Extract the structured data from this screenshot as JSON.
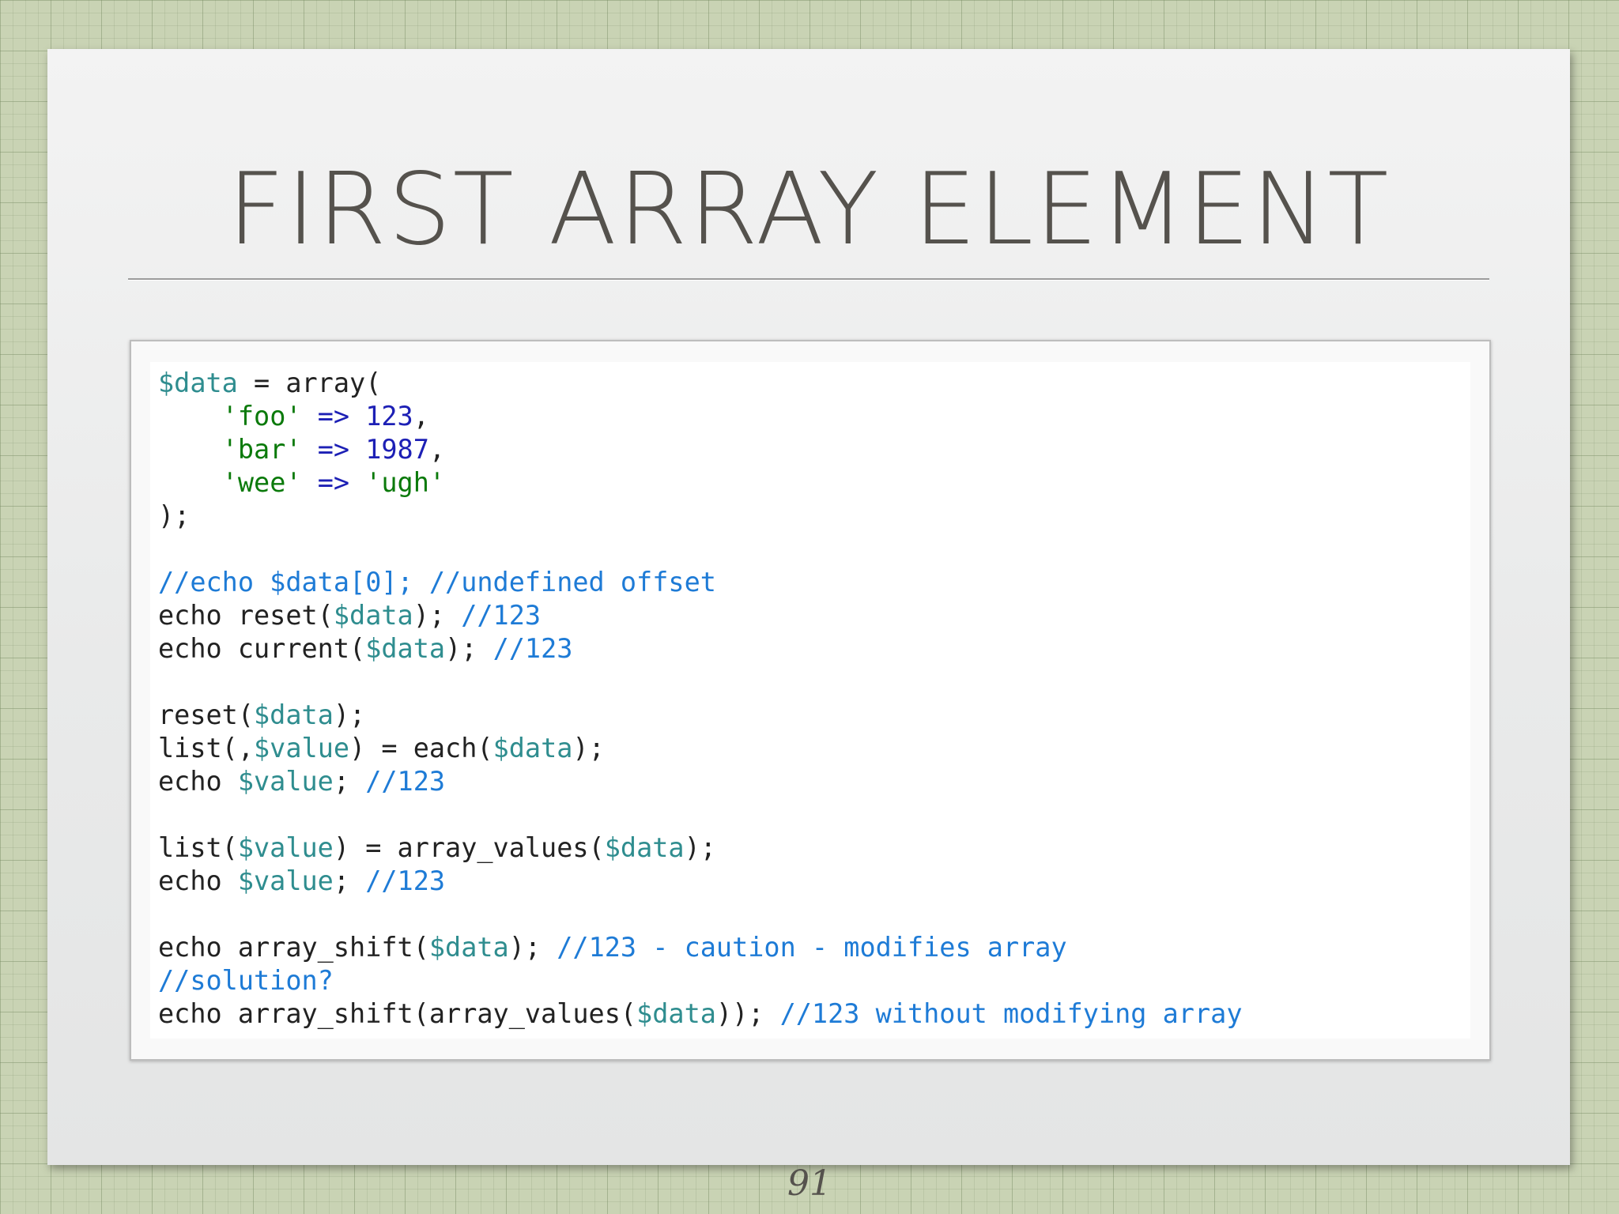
{
  "slide": {
    "title": "FIRST ARRAY ELEMENT",
    "page_number": "91"
  },
  "code_lines": [
    [
      [
        "var",
        "$data"
      ],
      [
        "txt",
        " = array("
      ]
    ],
    [
      [
        "txt",
        "    "
      ],
      [
        "str",
        "'foo'"
      ],
      [
        "txt",
        " "
      ],
      [
        "op",
        "=>"
      ],
      [
        "txt",
        " "
      ],
      [
        "num",
        "123"
      ],
      [
        "txt",
        ","
      ]
    ],
    [
      [
        "txt",
        "    "
      ],
      [
        "str",
        "'bar'"
      ],
      [
        "txt",
        " "
      ],
      [
        "op",
        "=>"
      ],
      [
        "txt",
        " "
      ],
      [
        "num",
        "1987"
      ],
      [
        "txt",
        ","
      ]
    ],
    [
      [
        "txt",
        "    "
      ],
      [
        "str",
        "'wee'"
      ],
      [
        "txt",
        " "
      ],
      [
        "op",
        "=>"
      ],
      [
        "txt",
        " "
      ],
      [
        "str",
        "'ugh'"
      ]
    ],
    [
      [
        "txt",
        ");"
      ]
    ],
    [],
    [
      [
        "com",
        "//echo $data[0]; //undefined offset"
      ]
    ],
    [
      [
        "txt",
        "echo reset("
      ],
      [
        "var",
        "$data"
      ],
      [
        "txt",
        "); "
      ],
      [
        "com",
        "//123"
      ]
    ],
    [
      [
        "txt",
        "echo current("
      ],
      [
        "var",
        "$data"
      ],
      [
        "txt",
        "); "
      ],
      [
        "com",
        "//123"
      ]
    ],
    [],
    [
      [
        "txt",
        "reset("
      ],
      [
        "var",
        "$data"
      ],
      [
        "txt",
        ");"
      ]
    ],
    [
      [
        "txt",
        "list(,"
      ],
      [
        "var",
        "$value"
      ],
      [
        "txt",
        ") = each("
      ],
      [
        "var",
        "$data"
      ],
      [
        "txt",
        ");"
      ]
    ],
    [
      [
        "txt",
        "echo "
      ],
      [
        "var",
        "$value"
      ],
      [
        "txt",
        "; "
      ],
      [
        "com",
        "//123"
      ]
    ],
    [],
    [
      [
        "txt",
        "list("
      ],
      [
        "var",
        "$value"
      ],
      [
        "txt",
        ") = array_values("
      ],
      [
        "var",
        "$data"
      ],
      [
        "txt",
        ");"
      ]
    ],
    [
      [
        "txt",
        "echo "
      ],
      [
        "var",
        "$value"
      ],
      [
        "txt",
        "; "
      ],
      [
        "com",
        "//123"
      ]
    ],
    [],
    [
      [
        "txt",
        "echo array_shift("
      ],
      [
        "var",
        "$data"
      ],
      [
        "txt",
        "); "
      ],
      [
        "com",
        "//123 - caution - modifies array"
      ]
    ],
    [
      [
        "com",
        "//solution?"
      ]
    ],
    [
      [
        "txt",
        "echo array_shift(array_values("
      ],
      [
        "var",
        "$data"
      ],
      [
        "txt",
        ")); "
      ],
      [
        "com",
        "//123 without modifying array"
      ]
    ]
  ],
  "colors": {
    "variable": "#2f8d8f",
    "string": "#0b7a0b",
    "number": "#1d20b5",
    "operator": "#1d20b5",
    "comment": "#1e7bd6",
    "text": "#222222"
  }
}
